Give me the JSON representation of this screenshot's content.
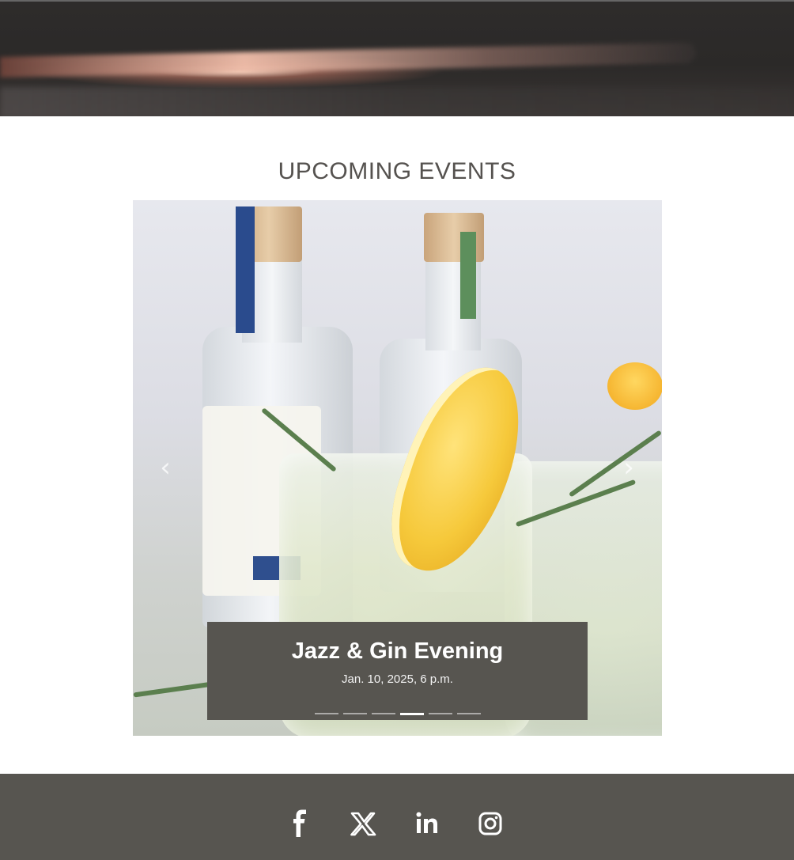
{
  "page": {
    "section_title": "UPCOMING EVENTS"
  },
  "carousel": {
    "prev_icon": "chevron-left-icon",
    "next_icon": "chevron-right-icon",
    "prev_glyph": "‹",
    "next_glyph": "›",
    "slide_count": 6,
    "active_slide": 4,
    "slide": {
      "title": "Jazz & Gin Evening",
      "date": "Jan. 10, 2025, 6 p.m."
    }
  },
  "footer": {
    "social": [
      "facebook-icon",
      "x-icon",
      "linkedin-icon",
      "instagram-icon"
    ]
  },
  "colors": {
    "caption_bg": "#575550",
    "footer_bg": "#575550",
    "title_text": "#55524f"
  }
}
